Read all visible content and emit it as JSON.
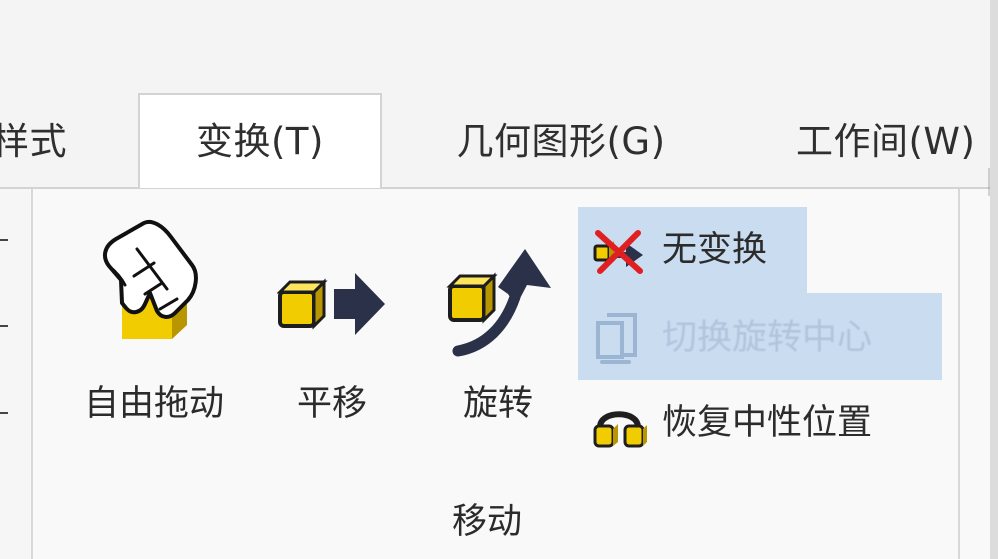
{
  "tabs": {
    "style": "样式",
    "transform": "变换(T)",
    "geometry": "几何图形(G)",
    "workspace": "工作间(W)"
  },
  "tools": {
    "free_drag": "自由拖动",
    "translate": "平移",
    "rotate": "旋转",
    "group_label": "移动"
  },
  "commands": {
    "no_transform": "无变换",
    "disabled_command": "切换旋转中心",
    "reset_neutral": "恢复中性位置"
  },
  "icons": {
    "free_drag": "hand-grab-cube-icon",
    "translate": "cube-right-arrow-icon",
    "rotate": "cube-rotation-arrow-icon",
    "no_transform": "red-x-arrow-icon",
    "disabled_command": "faint-pivot-icon",
    "reset_neutral": "headphone-reset-icon"
  },
  "colors": {
    "selected_highlight": "#c9dcf0",
    "active_tab": "#ffffff",
    "cube_yellow": "#f0cc00",
    "arrow_navy": "#2a3148",
    "warning_red": "#e02020"
  }
}
